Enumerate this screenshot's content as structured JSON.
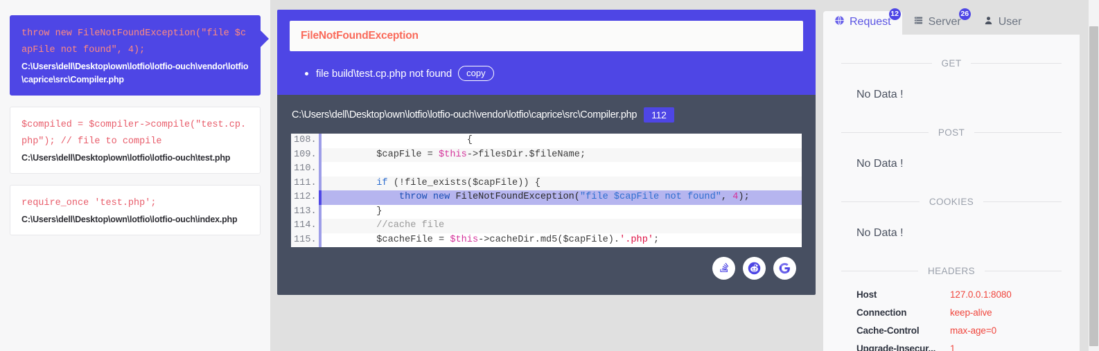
{
  "frames": [
    {
      "code": "throw new FileNotFoundException(\"file $capFile not found\", 4);",
      "path": "C:\\Users\\dell\\Desktop\\own\\lotfio\\lotfio-ouch\\vendor\\lotfio\\caprice\\src\\Compiler.php",
      "active": true
    },
    {
      "code": "$compiled = $compiler->compile(\"test.cp.php\"); // file to compile",
      "path": "C:\\Users\\dell\\Desktop\\own\\lotfio\\lotfio-ouch\\test.php",
      "active": false
    },
    {
      "code": "require_once 'test.php';",
      "path": "C:\\Users\\dell\\Desktop\\own\\lotfio\\lotfio-ouch\\index.php",
      "active": false
    }
  ],
  "exception": {
    "title": "FileNotFoundException",
    "message": "file build\\test.cp.php not found",
    "copy_label": "copy"
  },
  "source": {
    "file_path": "C:\\Users\\dell\\Desktop\\own\\lotfio\\lotfio-ouch\\vendor\\lotfio\\caprice\\src\\Compiler.php",
    "line_badge": "112",
    "highlight_line": 112,
    "lines": [
      {
        "n": "108.",
        "text": "                        {"
      },
      {
        "n": "109.",
        "text": "        $capFile = $this->filesDir.$fileName;"
      },
      {
        "n": "110.",
        "text": ""
      },
      {
        "n": "111.",
        "text": "        if (!file_exists($capFile)) {"
      },
      {
        "n": "112.",
        "text": "            throw new FileNotFoundException(\"file $capFile not found\", 4);"
      },
      {
        "n": "113.",
        "text": "        }"
      },
      {
        "n": "114.",
        "text": "        //cache file"
      },
      {
        "n": "115.",
        "text": "        $cacheFile = $this->cacheDir.md5($capFile).'.php';"
      }
    ]
  },
  "social": [
    {
      "name": "stackoverflow",
      "title": "Stack Overflow"
    },
    {
      "name": "reddit",
      "title": "Reddit"
    },
    {
      "name": "google",
      "title": "Google"
    }
  ],
  "right_panel": {
    "tabs": [
      {
        "id": "request",
        "label": "Request",
        "badge": "12",
        "icon": "globe-icon",
        "active": true
      },
      {
        "id": "server",
        "label": "Server",
        "badge": "26",
        "icon": "server-icon",
        "active": false
      },
      {
        "id": "user",
        "label": "User",
        "badge": "",
        "icon": "user-icon",
        "active": false
      }
    ],
    "sections": [
      {
        "label": "GET",
        "empty_text": "No Data !"
      },
      {
        "label": "POST",
        "empty_text": "No Data !"
      },
      {
        "label": "COOKIES",
        "empty_text": "No Data !"
      },
      {
        "label": "HEADERS",
        "empty_text": ""
      }
    ],
    "headers": [
      {
        "key": "Host",
        "value": "127.0.0.1:8080"
      },
      {
        "key": "Connection",
        "value": "keep-alive"
      },
      {
        "key": "Cache-Control",
        "value": "max-age=0"
      },
      {
        "key": "Upgrade-Insecur...",
        "value": "1"
      }
    ]
  },
  "colors": {
    "accent": "#4e46e5",
    "panel_dark": "#474f61",
    "error_red": "#fa6a5a",
    "header_value_red": "#f0453c",
    "page_bg": "#e0e0e0"
  }
}
